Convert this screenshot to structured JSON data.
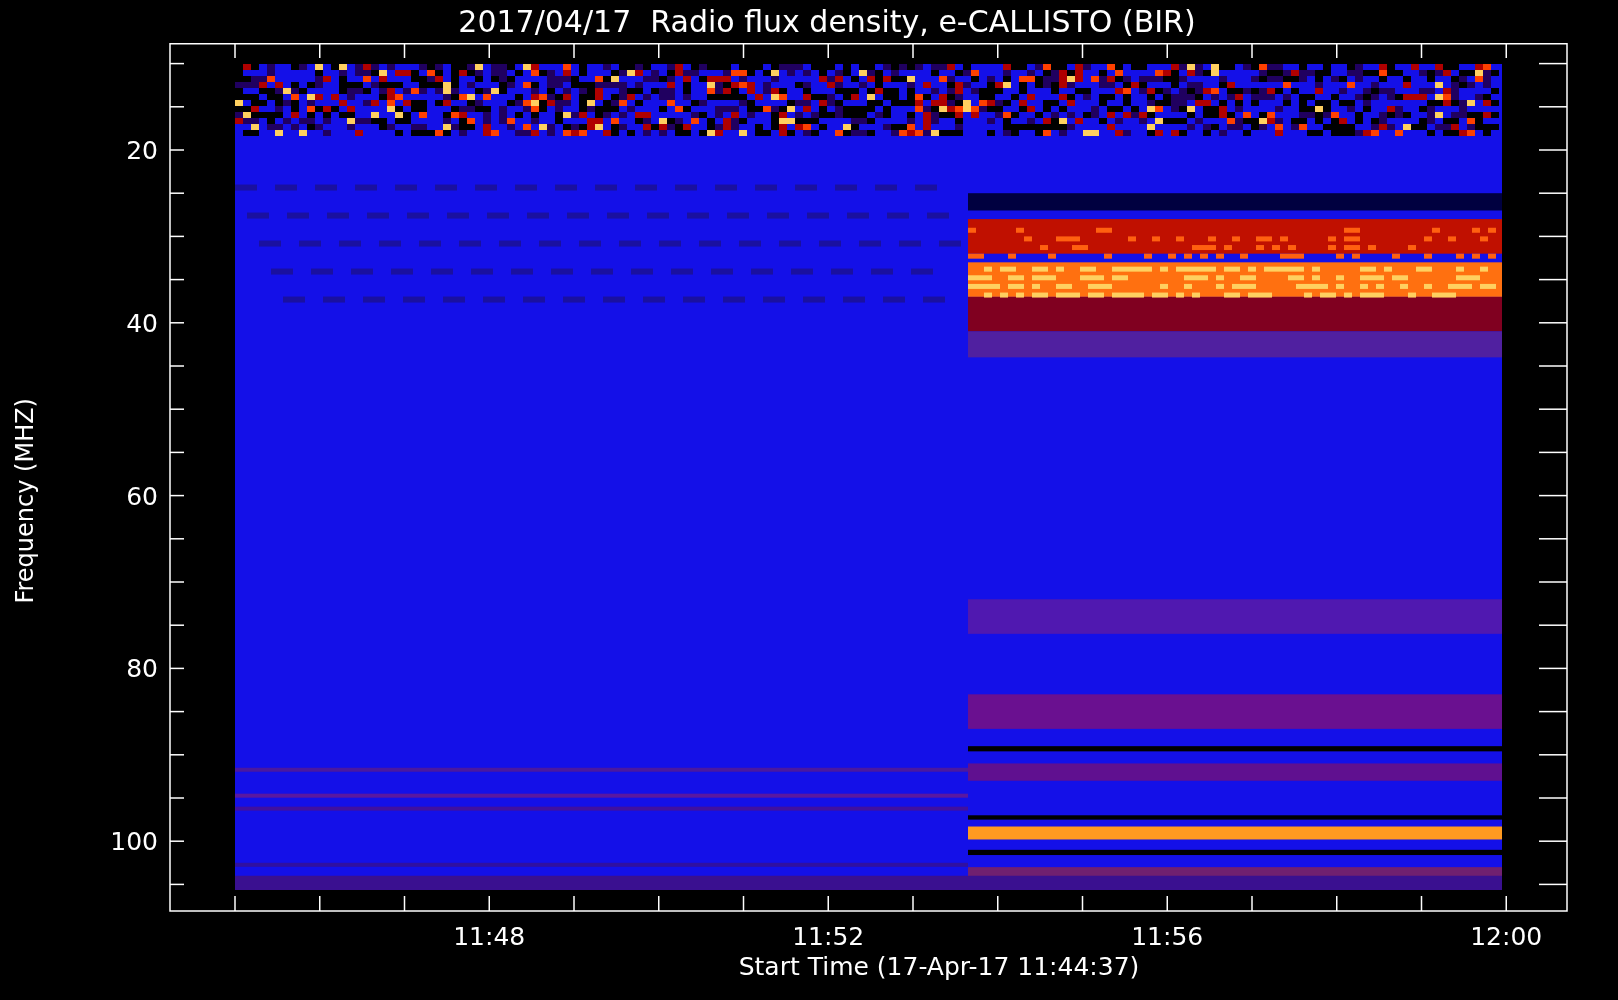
{
  "title": "2017/04/17  Radio flux density, e-CALLISTO (BIR)",
  "y_axis": {
    "label": "Frequency (MHZ)",
    "ticks": [
      "20",
      "40",
      "60",
      "80",
      "100"
    ]
  },
  "x_axis": {
    "label": "Start Time (17-Apr-17 11:44:37)",
    "ticks": [
      "11:48",
      "11:52",
      "11:56",
      "12:00"
    ]
  }
}
